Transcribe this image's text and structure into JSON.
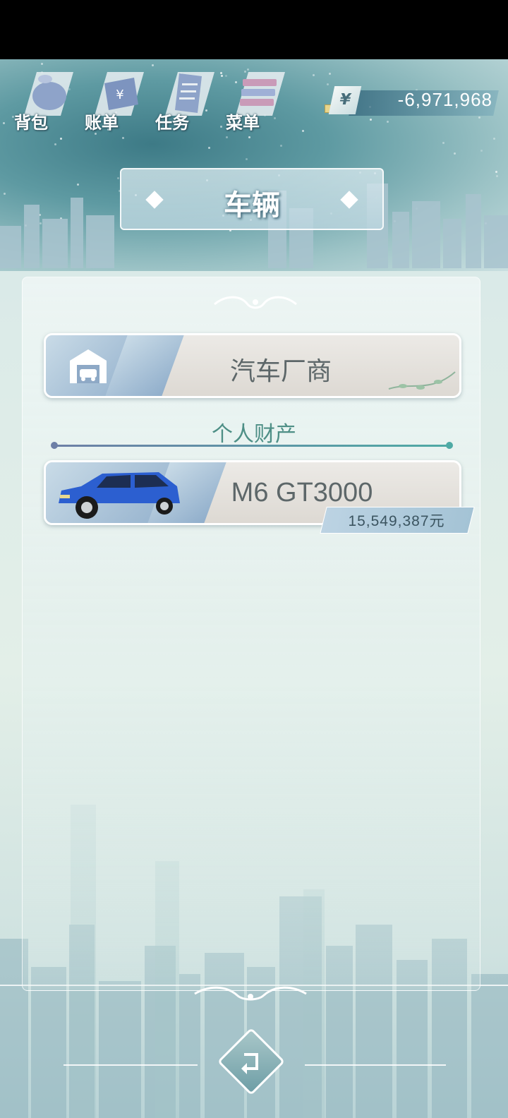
{
  "toolbar": {
    "items": [
      {
        "label": "背包",
        "icon": "bag-icon"
      },
      {
        "label": "账单",
        "icon": "bill-icon"
      },
      {
        "label": "任务",
        "icon": "task-icon"
      },
      {
        "label": "菜单",
        "icon": "menu-icon"
      }
    ]
  },
  "money": {
    "currency_symbol": "¥",
    "amount": "-6,971,968"
  },
  "page": {
    "title": "车辆"
  },
  "panel": {
    "dealer_button_label": "汽车厂商",
    "section_label": "个人财产",
    "vehicles": [
      {
        "name": "M6 GT3000",
        "price": "15,549,387元",
        "color": "#2c5fd0"
      }
    ]
  },
  "colors": {
    "accent": "#4faaa5",
    "text": "#5d6769",
    "sky": "#5e9aa2"
  }
}
